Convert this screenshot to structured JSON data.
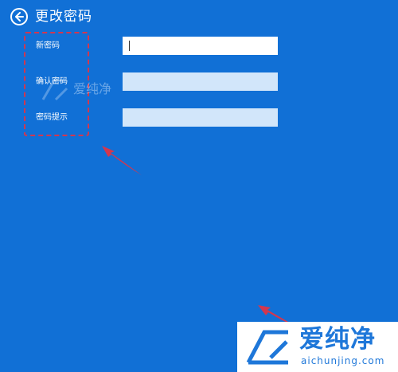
{
  "header": {
    "title": "更改密码",
    "back_icon": "arrow-left-circle-icon"
  },
  "form": {
    "new_password": {
      "label": "新密码",
      "value": ""
    },
    "confirm_password": {
      "label": "确认密码",
      "value": ""
    },
    "password_hint": {
      "label": "密码提示",
      "value": ""
    }
  },
  "watermark": {
    "small_text": "爱纯净",
    "brand_name": "爱纯净",
    "brand_domain": "aichunjing.com"
  },
  "colors": {
    "background": "#1170d6",
    "active_input": "#ffffff",
    "inactive_input": "#d2e6fa",
    "annotation_red": "#d2374f",
    "brand_blue": "#1e77d9"
  }
}
